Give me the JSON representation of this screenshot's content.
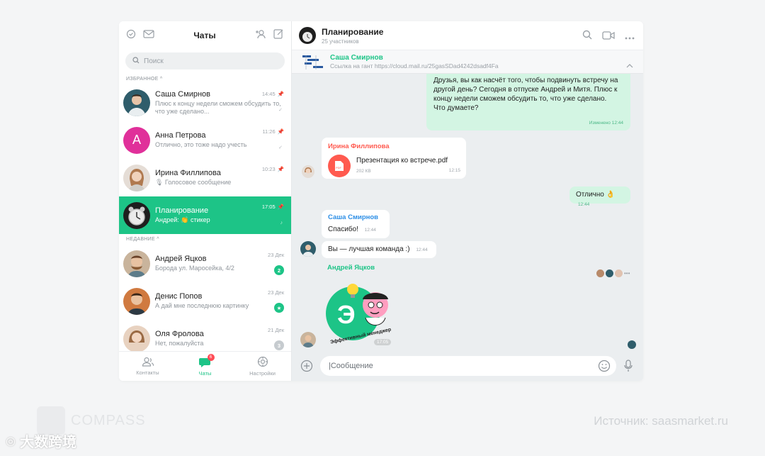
{
  "sidebar": {
    "title": "Чаты",
    "search_placeholder": "Поиск",
    "favorites_label": "ИЗБРАННОЕ ^",
    "recent_label": "НЕДАВНИЕ ^",
    "favorites": [
      {
        "name": "Саша Смирнов",
        "time": "14:45",
        "preview": "Плюс к концу недели сможем обсудить то, что уже сделано...",
        "status": "✓",
        "avatar_color": "#3a6a7a"
      },
      {
        "name": "Анна Петрова",
        "time": "11:26",
        "preview": "Отлично, это тоже надо учесть",
        "status": "✓",
        "avatar_letter": "A",
        "avatar_color": "#e0309a"
      },
      {
        "name": "Ирина Филлипова",
        "time": "10:23",
        "preview": "🎙 Голосовое сообщение",
        "avatar_color": "#c9a08a"
      },
      {
        "name": "Планирование",
        "time": "17:05",
        "preview": "Андрей: 👏 стикер",
        "avatar_color": "#2a2a2a",
        "active": true
      }
    ],
    "recent": [
      {
        "name": "Андрей Яцков",
        "time": "23 Дек",
        "preview": "Борода ул. Маросейка, 4/2",
        "badge": "2",
        "avatar_color": "#b88a6a"
      },
      {
        "name": "Денис Попов",
        "time": "23 Дек",
        "preview": "А дай мне последнюю картинку",
        "badge": "★",
        "avatar_color": "#c06a3a"
      },
      {
        "name": "Оля Фролова",
        "time": "21 Дек",
        "preview": "Нет, пожалуйста",
        "badge": "3",
        "avatar_color": "#d4a98a"
      }
    ],
    "nav": [
      {
        "label": "Контакты",
        "icon": "contacts-icon"
      },
      {
        "label": "Чаты",
        "icon": "chat-icon",
        "badge": "6",
        "active": true
      },
      {
        "label": "Настройки",
        "icon": "settings-icon"
      }
    ]
  },
  "chat": {
    "title": "Планирование",
    "subtitle": "25 участников",
    "pinned": {
      "name": "Саша Смирнов",
      "text": "Ссылка на гант https://cloud.mail.ru/25gasSDad4242dsadf4Fa"
    },
    "messages": {
      "m1_text": "Друзья, вы как насчёт того, чтобы подвинуть встречу на другой день? Сегодня в отпуске Андрей и Митя. Плюс к концу недели сможем обсудить то, что уже сделано.\nЧто думаете?",
      "m1_time": "Изменено 12:44",
      "m2_sender": "Ирина Филлипова",
      "m2_file": "Презентация ко встрече.pdf",
      "m2_size": "202 КВ",
      "m2_time": "12:15",
      "m2_file_type": "PDF",
      "m3_text": "Отлично 👌",
      "m3_time": "12:44",
      "m4_sender": "Саша Смирнов",
      "m4_text": "Спасибо!",
      "m4_time": "12:44",
      "m5_text": "Вы — лучшая команда :)",
      "m5_time": "12:44",
      "m6_sender": "Андрей Яцков",
      "m6_sticker_text": "Эффективный менеджер",
      "m6_sticker_letter": "Э",
      "m6_time": "17:05"
    },
    "composer_placeholder": "|Сообщение"
  },
  "watermarks": {
    "compass": "COMPASS",
    "source": "Источник: saasmarket.ru",
    "cn": "大数跨境"
  },
  "colors": {
    "accent": "#1dc487",
    "outgoing_bubble": "#d3f5e3",
    "chat_bg": "#ebeef0",
    "ira_name": "#ff5a4f",
    "sasha_name": "#2c8ee6"
  }
}
